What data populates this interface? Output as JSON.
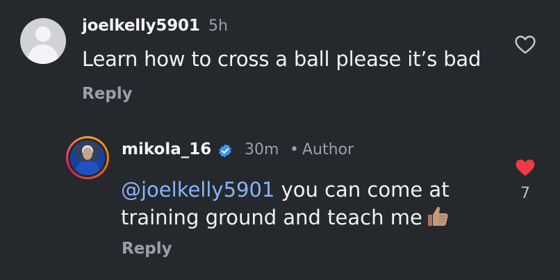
{
  "comments": [
    {
      "username": "joelkelly5901",
      "time": "5h",
      "text": "Learn how to cross a ball please it’s bad",
      "reply_label": "Reply",
      "avatar": "default-avatar-icon",
      "liked": false
    }
  ],
  "reply": {
    "username": "mikola_16",
    "verified": true,
    "time": "30m",
    "separator": "•",
    "author_badge": "Author",
    "mention": "@joelkelly5901",
    "line1_rest": " you can come at",
    "line2": "training ground and teach me",
    "emoji": "thumbs-up-icon",
    "reply_label": "Reply",
    "liked": true,
    "like_count": "7"
  },
  "colors": {
    "background": "#25292e",
    "primary_text": "#f2f2f2",
    "secondary_text": "#9aa0a6",
    "mention": "#8ab4f8",
    "verified": "#3797f0",
    "like_active": "#ed3b43"
  }
}
